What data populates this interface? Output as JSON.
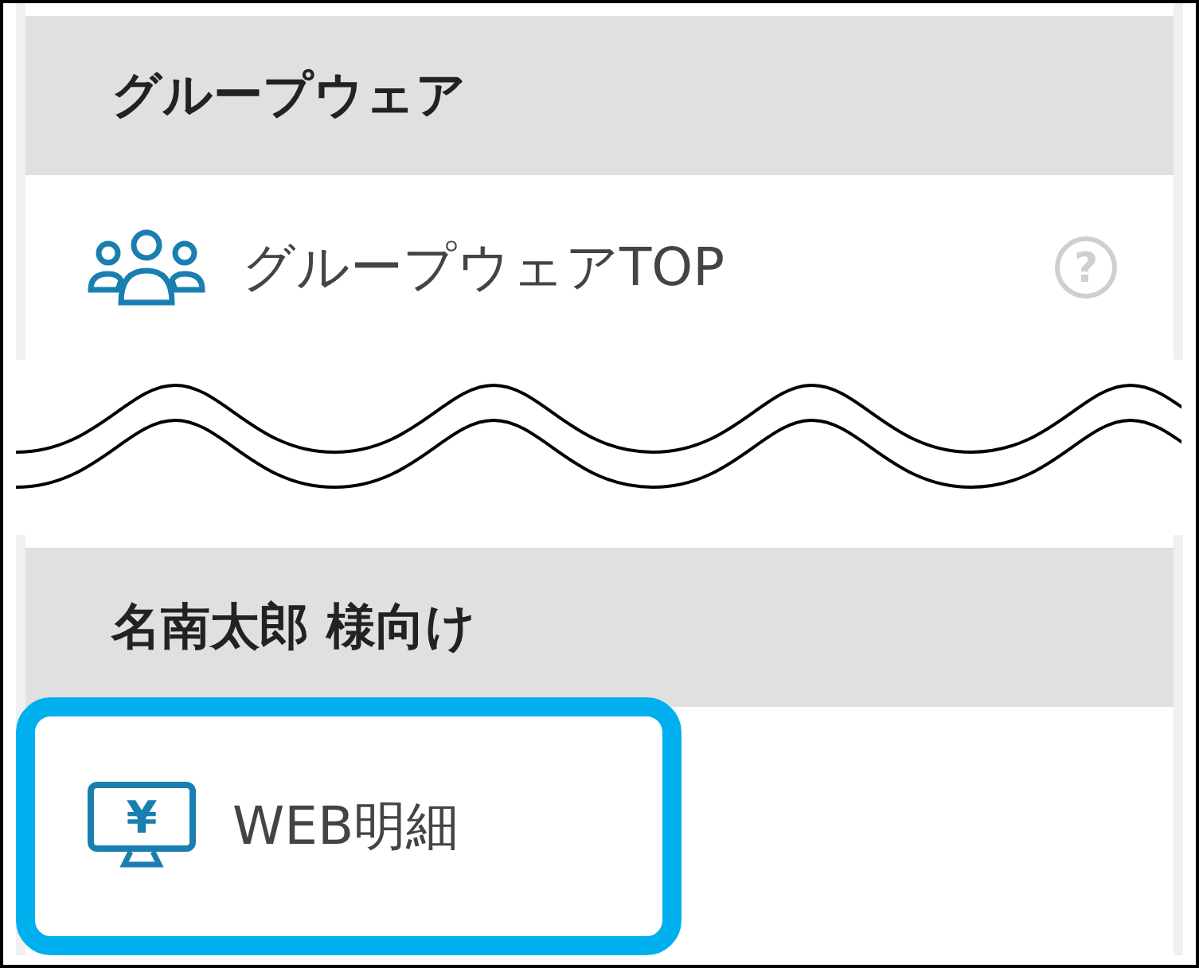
{
  "blocks": [
    {
      "kind": "section",
      "header": "グループウェア",
      "items": [
        {
          "label": "グループウェアTOP",
          "kind": "groupware",
          "help": "?",
          "highlighted": false
        }
      ]
    },
    {
      "kind": "break"
    },
    {
      "kind": "section",
      "header": "名南太郎 様向け",
      "items": [
        {
          "label": "WEB明細",
          "kind": "statement",
          "glyph": "¥",
          "highlighted": true
        }
      ]
    }
  ]
}
